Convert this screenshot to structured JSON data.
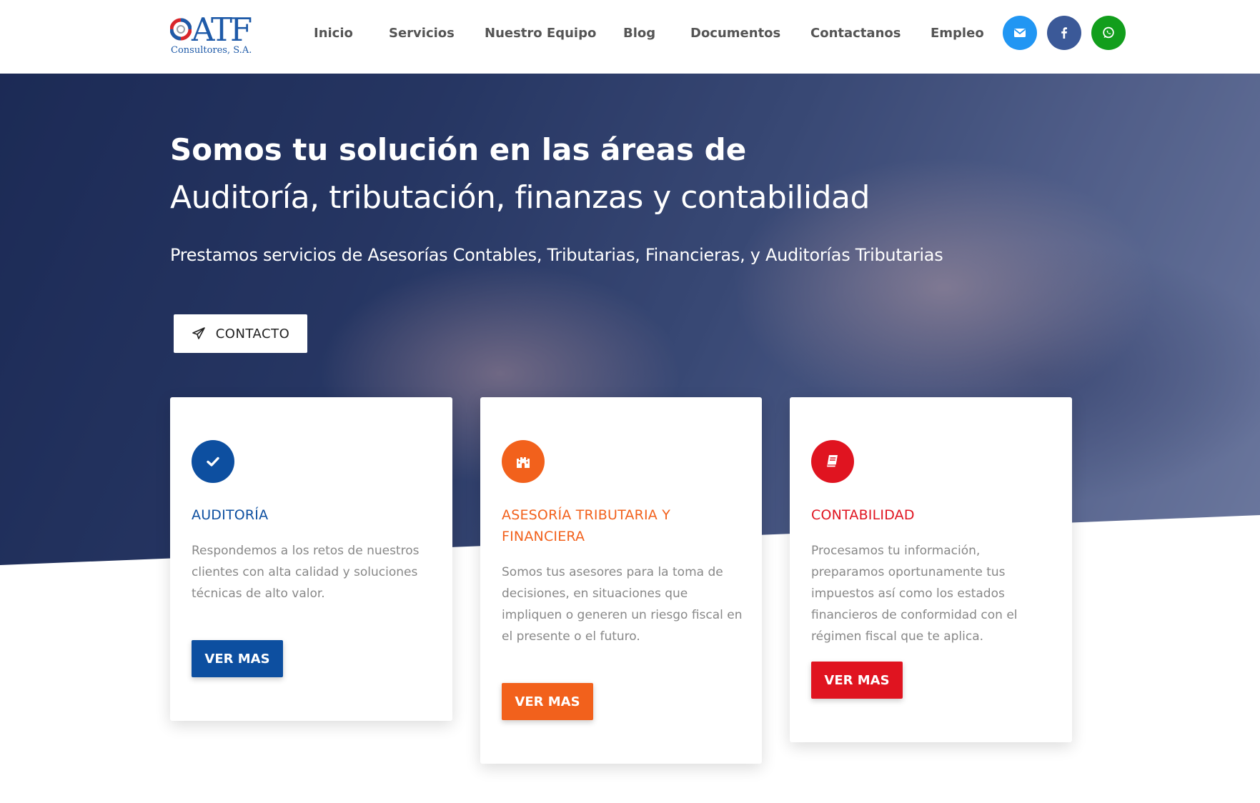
{
  "brand": {
    "logo_text": "ATF",
    "logo_subtext": "Consultores, S.A."
  },
  "nav": {
    "items": [
      {
        "label": "Inicio"
      },
      {
        "label": "Servicios"
      },
      {
        "label": "Nuestro Equipo"
      },
      {
        "label": "Blog"
      },
      {
        "label": "Documentos"
      },
      {
        "label": "Contactanos"
      },
      {
        "label": "Empleo"
      }
    ]
  },
  "social": [
    {
      "icon": "envelope-icon",
      "color": "#2196f3"
    },
    {
      "icon": "facebook-icon",
      "color": "#3b5998"
    },
    {
      "icon": "whatsapp-icon",
      "color": "#129e1c"
    }
  ],
  "hero": {
    "title": "Somos tu solución en las áreas de",
    "subtitle": "Auditoría, tributación, finanzas y contabilidad",
    "text": "Prestamos servicios de Asesorías Contables, Tributarias, Financieras, y Auditorías Tributarias",
    "button_label": "CONTACTO",
    "button_icon": "paper-plane-icon"
  },
  "cards": [
    {
      "icon": "check-icon",
      "color": "#0d4fa0",
      "title": "AUDITORÍA",
      "text": "Respondemos a los retos de nuestros clientes con alta calidad y soluciones técnicas de alto valor.",
      "button_label": "VER MAS"
    },
    {
      "icon": "castle-icon",
      "color": "#f2611c",
      "title": "ASESORÍA TRIBUTARIA Y FINANCIERA",
      "text": "Somos tus asesores para la toma de decisiones, en situaciones que impliquen o generen un riesgo fiscal en el presente o el futuro.",
      "button_label": "VER MAS"
    },
    {
      "icon": "book-icon",
      "color": "#e01420",
      "title": "CONTABILIDAD",
      "text": "Procesamos tu información, preparamos oportunamente tus impuestos así como los estados financieros de conformidad con el régimen fiscal que te aplica.",
      "button_label": "VER MAS"
    }
  ]
}
